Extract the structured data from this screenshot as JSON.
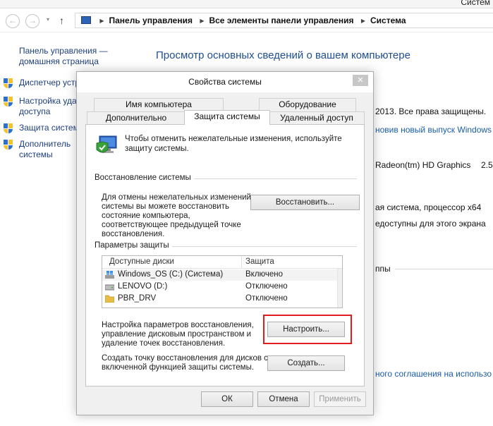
{
  "window": {
    "title_partial": "Систем"
  },
  "nav": {
    "back_glyph": "←",
    "forward_glyph": "→",
    "dropdown_glyph": "▾",
    "up_glyph": "↑",
    "separator_glyph": "▶",
    "breadcrumbs": [
      "Панель управления",
      "Все элементы панели управления",
      "Система"
    ]
  },
  "sidebar": {
    "home_line1": "Панель управления —",
    "home_line2": "домашняя страница",
    "items": [
      {
        "line1": "Диспетчер устр",
        "line2": ""
      },
      {
        "line1": "Настройка уда",
        "line2": "доступа"
      },
      {
        "line1": "Защита систем",
        "line2": ""
      },
      {
        "line1": "Дополнитель",
        "line2": "системы"
      }
    ]
  },
  "main": {
    "heading": "Просмотр основных сведений о вашем компьютере",
    "copyright": "2013. Все права защищены.",
    "update_link": "новив новый выпуск Windows",
    "graphics": "Radeon(tm) HD Graphics",
    "graphics_val": "2.50",
    "system_type": "ая система, процессор x64",
    "touch": "едоступны для этого экрана",
    "workgroup": "ппы",
    "license_link": "ного соглашения на использо"
  },
  "dialog": {
    "title": "Свойства системы",
    "close_glyph": "✕",
    "tabs_top": [
      "Имя компьютера",
      "Оборудование"
    ],
    "tabs_bottom": [
      "Дополнительно",
      "Защита системы",
      "Удаленный доступ"
    ],
    "intro_line1": "Чтобы отменить нежелательные изменения, используйте",
    "intro_line2": "защиту системы.",
    "restore_group": "Восстановление системы",
    "restore_desc": [
      "Для отмены нежелательных изменений",
      "системы вы можете восстановить",
      "состояние компьютера,",
      "соответствующее предыдущей точке",
      "восстановления."
    ],
    "restore_button": "Восстановить...",
    "protection_group": "Параметры защиты",
    "list_headers": {
      "drives": "Доступные диски",
      "protection": "Защита"
    },
    "drives": [
      {
        "name": "Windows_OS (C:) (Система)",
        "protection": "Включено",
        "icon": "windows-drive-icon"
      },
      {
        "name": "LENOVO (D:)",
        "protection": "Отключено",
        "icon": "hard-drive-icon"
      },
      {
        "name": "PBR_DRV",
        "protection": "Отключено",
        "icon": "folder-icon"
      }
    ],
    "configure_desc": [
      "Настройка параметров восстановления,",
      "управление дисковым пространством и",
      "удаление точек восстановления."
    ],
    "configure_button": "Настроить...",
    "create_desc": [
      "Создать точку восстановления для дисков с",
      "включенной функцией защиты системы."
    ],
    "create_button": "Создать...",
    "ok_button": "ОК",
    "cancel_button": "Отмена",
    "apply_button": "Применить"
  },
  "colors": {
    "highlight": "#e01c1c",
    "link": "#1a5dab",
    "heading": "#1e4e8f"
  }
}
